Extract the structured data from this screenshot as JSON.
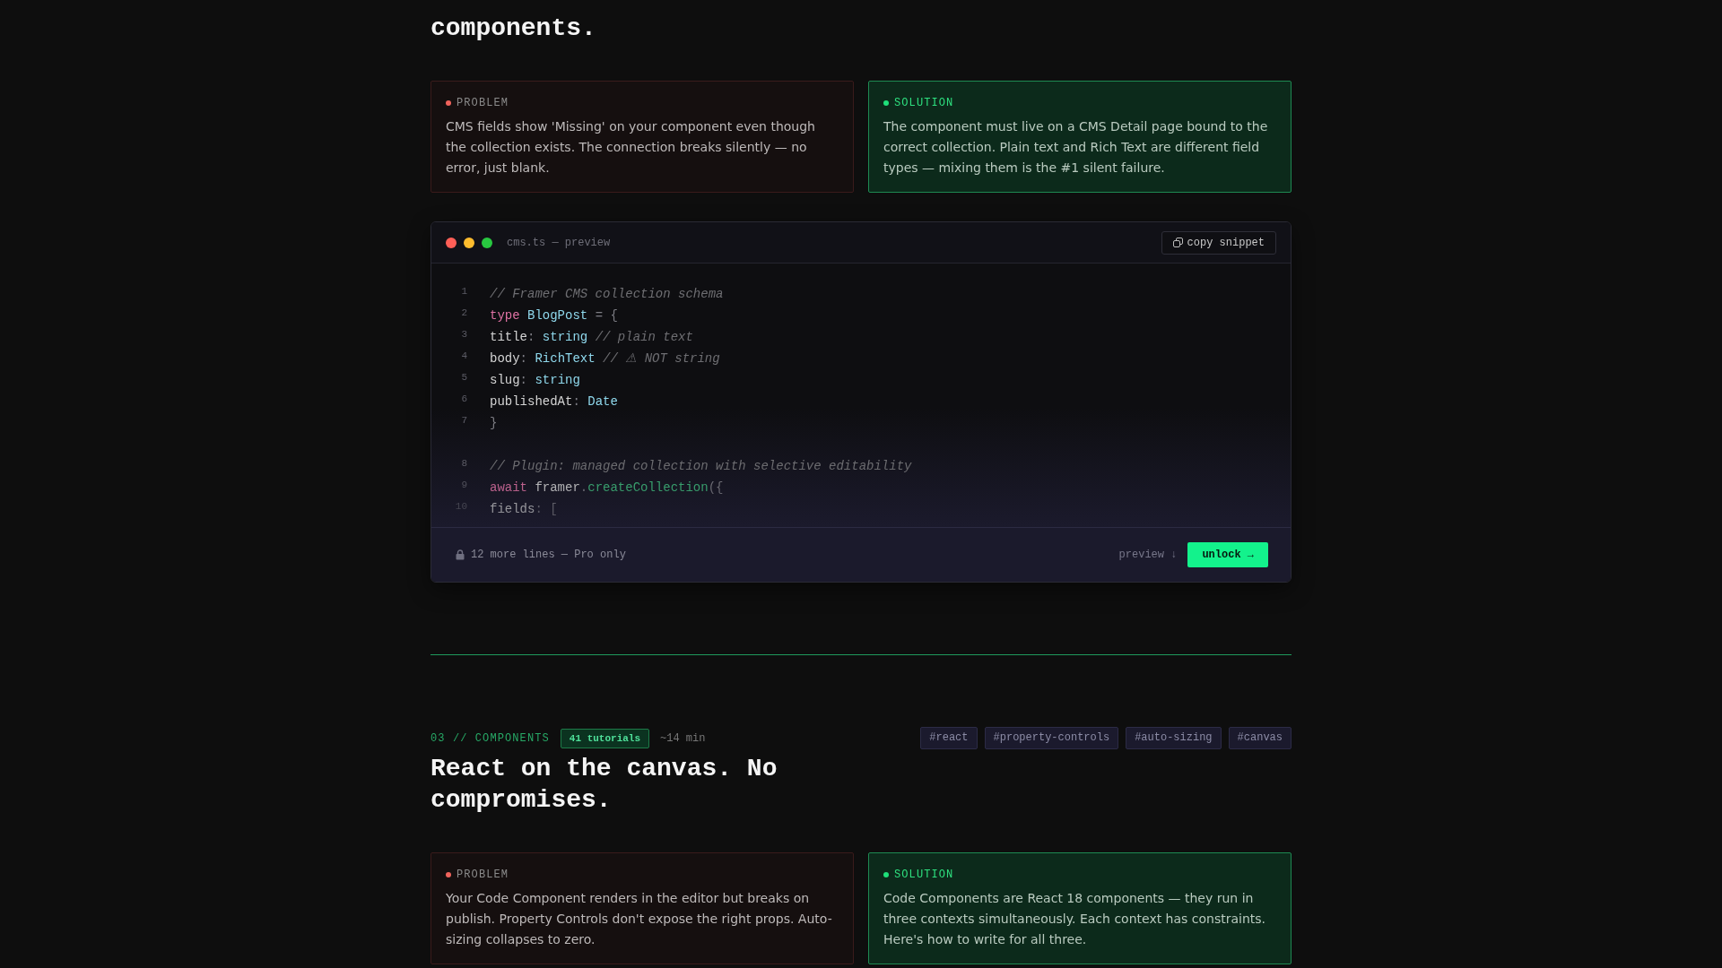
{
  "sections": [
    {
      "heading": "components.",
      "cards": [
        {
          "kind": "problem",
          "label": "PROBLEM",
          "text": "CMS fields show 'Missing' on your component even though the collection exists. The connection breaks silently — no error, just blank."
        },
        {
          "kind": "solution",
          "label": "SOLUTION",
          "text": "The component must live on a CMS Detail page bound to the correct collection. Plain text and Rich Text are different field types — mixing them is the #1 silent failure."
        }
      ],
      "code_panel": {
        "filename": "cms.ts — preview",
        "copy_button": "copy snippet",
        "lines": [
          {
            "kind": "code",
            "number": "1",
            "tokens": [
              {
                "kind": "comment",
                "text": "// Framer CMS collection schema"
              }
            ]
          },
          {
            "kind": "code",
            "number": "2",
            "tokens": [
              {
                "kind": "keyword",
                "text": "type"
              },
              {
                "kind": "type",
                "text": " BlogPost"
              },
              {
                "kind": "punct",
                "text": " = {"
              }
            ]
          },
          {
            "kind": "code",
            "number": "3",
            "tokens": [
              {
                "kind": "plain",
                "text": "title"
              },
              {
                "kind": "punct",
                "text": ": "
              },
              {
                "kind": "type",
                "text": "string"
              },
              {
                "kind": "comment",
                "text": " // plain text"
              }
            ]
          },
          {
            "kind": "code",
            "number": "4",
            "tokens": [
              {
                "kind": "plain",
                "text": "body"
              },
              {
                "kind": "punct",
                "text": ": "
              },
              {
                "kind": "type",
                "text": "RichText"
              },
              {
                "kind": "comment",
                "text": " // ⚠ NOT string"
              }
            ]
          },
          {
            "kind": "code",
            "number": "5",
            "tokens": [
              {
                "kind": "plain",
                "text": "slug"
              },
              {
                "kind": "punct",
                "text": ": "
              },
              {
                "kind": "type",
                "text": "string"
              }
            ]
          },
          {
            "kind": "code",
            "number": "6",
            "tokens": [
              {
                "kind": "plain",
                "text": "publishedAt"
              },
              {
                "kind": "punct",
                "text": ": "
              },
              {
                "kind": "type",
                "text": "Date"
              }
            ]
          },
          {
            "kind": "code",
            "number": "7",
            "tokens": [
              {
                "kind": "punct",
                "text": "}"
              }
            ]
          },
          {
            "kind": "blank"
          },
          {
            "kind": "code",
            "number": "8",
            "tokens": [
              {
                "kind": "comment",
                "text": "// Plugin: managed collection with selective editability"
              }
            ]
          },
          {
            "kind": "code",
            "number": "9",
            "tokens": [
              {
                "kind": "keyword",
                "text": "await"
              },
              {
                "kind": "plain",
                "text": " framer"
              },
              {
                "kind": "punct",
                "text": "."
              },
              {
                "kind": "method",
                "text": "createCollection"
              },
              {
                "kind": "punct",
                "text": "({"
              }
            ]
          },
          {
            "kind": "code",
            "number": "10",
            "tokens": [
              {
                "kind": "plain",
                "text": "fields"
              },
              {
                "kind": "punct",
                "text": ": ["
              }
            ]
          }
        ],
        "footer": {
          "locked_note": "12 more lines — Pro only",
          "preview_link": "preview ↓",
          "unlock_button": "unlock →"
        }
      }
    },
    {
      "header": {
        "eyebrow": "03 // COMPONENTS",
        "badge": "41 tutorials",
        "duration": "~14 min",
        "tags": [
          "#react",
          "#property-controls",
          "#auto-sizing",
          "#canvas"
        ]
      },
      "heading": "React on the canvas. No compromises.",
      "cards": [
        {
          "kind": "problem",
          "label": "PROBLEM",
          "text": "Your Code Component renders in the editor but breaks on publish. Property Controls don't expose the right props. Auto-sizing collapses to zero."
        },
        {
          "kind": "solution",
          "label": "SOLUTION",
          "text": "Code Components are React 18 components — they run in three contexts simultaneously. Each context has constraints. Here's how to write for all three."
        }
      ]
    }
  ]
}
